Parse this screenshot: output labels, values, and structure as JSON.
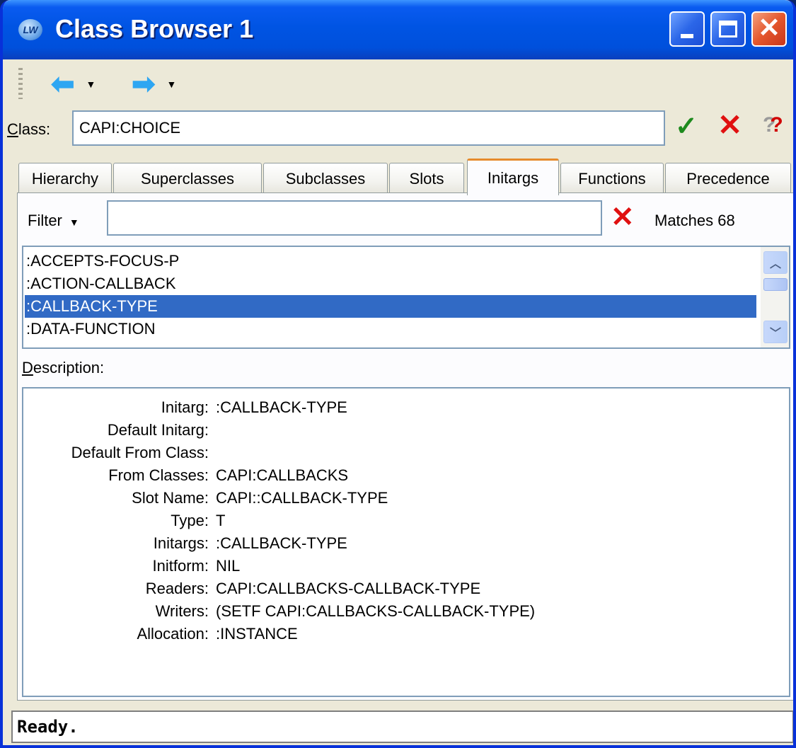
{
  "window": {
    "title": "Class Browser 1",
    "app_icon": "lispworks-icon",
    "controls": [
      "minimize-icon",
      "maximize-icon",
      "close-icon"
    ]
  },
  "toolbar": {
    "back_icon": "arrow-left-icon",
    "forward_icon": "arrow-right-icon"
  },
  "class_row": {
    "label_accel": "C",
    "label_rest": "lass:",
    "value": "CAPI:CHOICE",
    "actions": [
      "check-icon",
      "cancel-icon",
      "help-icon"
    ]
  },
  "tabs": [
    {
      "label": "Hierarchy",
      "active": false
    },
    {
      "label": "Superclasses",
      "active": false
    },
    {
      "label": "Subclasses",
      "active": false
    },
    {
      "label": "Slots",
      "active": false
    },
    {
      "label": "Initargs",
      "active": true
    },
    {
      "label": "Functions",
      "active": false
    },
    {
      "label": "Precedence",
      "active": false
    }
  ],
  "filter": {
    "label": "Filter",
    "value": "",
    "matches": "Matches 68"
  },
  "initargs_list": {
    "items": [
      {
        "label": ":ACCEPTS-FOCUS-P",
        "selected": false
      },
      {
        "label": ":ACTION-CALLBACK",
        "selected": false
      },
      {
        "label": ":CALLBACK-TYPE",
        "selected": true
      },
      {
        "label": ":DATA-FUNCTION",
        "selected": false
      }
    ]
  },
  "description": {
    "label_accel": "D",
    "label_rest": "escription:",
    "rows": [
      {
        "key": "Initarg:",
        "value": ":CALLBACK-TYPE"
      },
      {
        "key": "Default Initarg:",
        "value": ""
      },
      {
        "key": "Default From Class:",
        "value": ""
      },
      {
        "key": "From Classes:",
        "value": "CAPI:CALLBACKS"
      },
      {
        "key": "Slot Name:",
        "value": "CAPI::CALLBACK-TYPE"
      },
      {
        "key": "Type:",
        "value": "T"
      },
      {
        "key": "Initargs:",
        "value": ":CALLBACK-TYPE"
      },
      {
        "key": "Initform:",
        "value": "NIL"
      },
      {
        "key": "Readers:",
        "value": "CAPI:CALLBACKS-CALLBACK-TYPE"
      },
      {
        "key": "Writers:",
        "value": "(SETF CAPI:CALLBACKS-CALLBACK-TYPE)"
      },
      {
        "key": "Allocation:",
        "value": ":INSTANCE"
      }
    ]
  },
  "status": {
    "text": "Ready."
  }
}
